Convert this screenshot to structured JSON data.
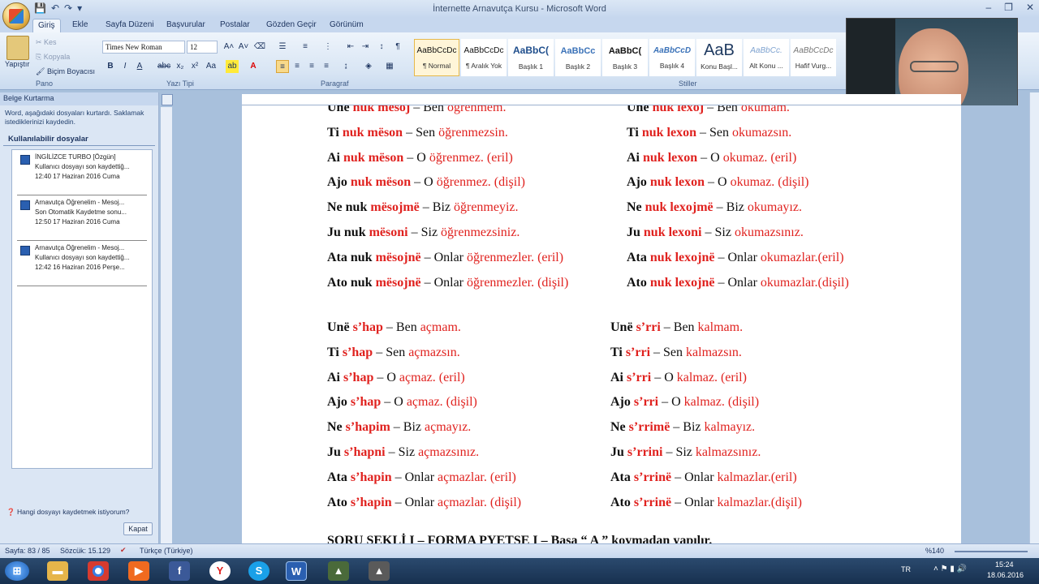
{
  "window": {
    "title": "İnternette Arnavutça Kursu - Microsoft Word"
  },
  "tabs": [
    "Giriş",
    "Ekle",
    "Sayfa Düzeni",
    "Başvurular",
    "Postalar",
    "Gözden Geçir",
    "Görünüm"
  ],
  "ribbon": {
    "clipboard": {
      "paste": "Yapıştır",
      "cut": "Kes",
      "copy": "Kopyala",
      "format_painter": "Biçim Boyacısı",
      "group": "Pano"
    },
    "font": {
      "name": "Times New Roman",
      "size": "12",
      "group": "Yazı Tipi"
    },
    "paragraph": {
      "group": "Paragraf"
    },
    "styles": {
      "group": "Stiller",
      "items": [
        {
          "preview": "AaBbCcDc",
          "name": "¶ Normal"
        },
        {
          "preview": "AaBbCcDc",
          "name": "¶ Aralık Yok"
        },
        {
          "preview": "AaBbC(",
          "name": "Başlık 1"
        },
        {
          "preview": "AaBbCc",
          "name": "Başlık 2"
        },
        {
          "preview": "AaBbC(",
          "name": "Başlık 3"
        },
        {
          "preview": "AaBbCcD",
          "name": "Başlık 4"
        },
        {
          "preview": "AaB",
          "name": "Konu Başl..."
        },
        {
          "preview": "AaBbCc.",
          "name": "Alt Konu ..."
        },
        {
          "preview": "AaBbCcDc",
          "name": "Hafif Vurg..."
        }
      ]
    }
  },
  "recovery": {
    "title": "Belge Kurtarma",
    "info": "Word, aşağıdaki dosyaları kurtardı.  Saklamak istediklerinizi kaydedin.",
    "available": "Kullanılabilir dosyalar",
    "files": [
      {
        "name": "İNGİLİZCE TURBO  [Özgün]",
        "status": "Kullanıcı dosyayı son kaydettiğ...",
        "time": "12:40 17 Haziran 2016 Cuma"
      },
      {
        "name": "Arnavutça Öğrenelim - Mesoj...",
        "status": "Son Otomatik Kaydetme sonu...",
        "time": "12:50 17 Haziran 2016 Cuma"
      },
      {
        "name": "Arnavutça Öğrenelim - Mesoj...",
        "status": "Kullanıcı dosyayı son kaydettiğ...",
        "time": "12:42 16 Haziran 2016 Perşe..."
      }
    ],
    "question": "Hangi dosyayı kaydetmek istiyorum?",
    "close": "Kapat"
  },
  "document": {
    "rows": [
      {
        "l1a": "Unë",
        "l1b": "nuk mësoj",
        "l2": "– Ben",
        "l3": "öğrenmem.",
        "r1a": "Unë",
        "r1b": "nuk lexoj",
        "r2": "– Ben",
        "r3": "okumam."
      },
      {
        "l1a": "Ti",
        "l1b": "nuk mëson",
        "l2": "– Sen",
        "l3": "öğrenmezsin.",
        "r1a": "Ti",
        "r1b": "nuk lexon",
        "r2": "– Sen",
        "r3": "okumazsın."
      },
      {
        "l1a": "Ai",
        "l1b": "nuk mëson",
        "l2": "– O",
        "l3": "öğrenmez. (eril)",
        "r1a": "Ai",
        "r1b": "nuk lexon",
        "r2": "– O",
        "r3": "okumaz. (eril)"
      },
      {
        "l1a": "Ajo",
        "l1b": "nuk mëson",
        "l2": "– O",
        "l3": "öğrenmez. (dişil)",
        "r1a": "Ajo",
        "r1b": "nuk lexon",
        "r2": "– O",
        "r3": "okumaz. (dişil)"
      },
      {
        "l1a": "Ne nuk",
        "l1b": "mësojmë",
        "l2": "– Biz",
        "l3": "öğrenmeyiz.",
        "r1a": "Ne",
        "r1b": "nuk lexojmë",
        "r2": "– Biz",
        "r3": "okumayız."
      },
      {
        "l1a": "Ju nuk",
        "l1b": "mësoni",
        "l2": "– Siz",
        "l3": "öğrenmezsiniz.",
        "r1a": "Ju",
        "r1b": "nuk lexoni",
        "r2": "– Siz",
        "r3": "okumazsınız."
      },
      {
        "l1a": "Ata nuk",
        "l1b": "mësojnë",
        "l2": "– Onlar",
        "l3": "öğrenmezler. (eril)",
        "r1a": "Ata",
        "r1b": "nuk lexojnë",
        "r2": "– Onlar",
        "r3": "okumazlar.(eril)"
      },
      {
        "l1a": "Ato nuk",
        "l1b": "mësojnë",
        "l2": "– Onlar",
        "l3": "öğrenmezler. (dişil)",
        "r1a": "Ato",
        "r1b": "nuk lexojnë",
        "r2": "– Onlar",
        "r3": "okumazlar.(dişil)"
      }
    ],
    "rows2": [
      {
        "l1a": "Unë",
        "l1b": "s’hap",
        "l2": "– Ben",
        "l3": "açmam.",
        "r1a": "Unë",
        "r1b": "s’rri",
        "r2": "– Ben",
        "r3": "kalmam."
      },
      {
        "l1a": "Ti",
        "l1b": "s’hap",
        "l2": "– Sen",
        "l3": "açmazsın.",
        "r1a": "Ti",
        "r1b": "s’rri",
        "r2": "– Sen",
        "r3": "kalmazsın."
      },
      {
        "l1a": "Ai",
        "l1b": "s’hap",
        "l2": "– O",
        "l3": "açmaz. (eril)",
        "r1a": "Ai",
        "r1b": "s’rri",
        "r2": "– O",
        "r3": "kalmaz. (eril)"
      },
      {
        "l1a": "Ajo",
        "l1b": "s’hap",
        "l2": "– O",
        "l3": "açmaz. (dişil)",
        "r1a": "Ajo",
        "r1b": "s’rri",
        "r2": "– O",
        "r3": "kalmaz. (dişil)"
      },
      {
        "l1a": "Ne",
        "l1b": "s’hapim",
        "l2": "– Biz",
        "l3": "açmayız.",
        "r1a": "Ne",
        "r1b": "s’rrimë",
        "r2": "– Biz",
        "r3": "kalmayız."
      },
      {
        "l1a": "Ju",
        "l1b": "s’hapni",
        "l2": "– Siz",
        "l3": "açmazsınız.",
        "r1a": "Ju",
        "r1b": "s’rrini",
        "r2": "– Siz",
        "r3": "kalmazsınız."
      },
      {
        "l1a": "Ata",
        "l1b": "s’hapin",
        "l2": "– Onlar",
        "l3": "açmazlar. (eril)",
        "r1a": "Ata",
        "r1b": "s’rrinë",
        "r2": "– Onlar",
        "r3": "kalmazlar.(eril)"
      },
      {
        "l1a": "Ato",
        "l1b": "s’hapin",
        "l2": "– Onlar",
        "l3": "açmazlar. (dişil)",
        "r1a": "Ato",
        "r1b": "s’rrinë",
        "r2": "– Onlar",
        "r3": "kalmazlar.(dişil)"
      }
    ],
    "bottom": "SORU  ŞEKLİ  I – FORMA  PYETSE  I – Başa “ A ” koymadan yapılır."
  },
  "status": {
    "page": "Sayfa: 83 / 85",
    "words": "Sözcük: 15.129",
    "lang": "Türkçe (Türkiye)",
    "zoom": "%140"
  },
  "taskbar": {
    "lang": "TR",
    "time": "15:24",
    "date": "18.06.2016"
  }
}
